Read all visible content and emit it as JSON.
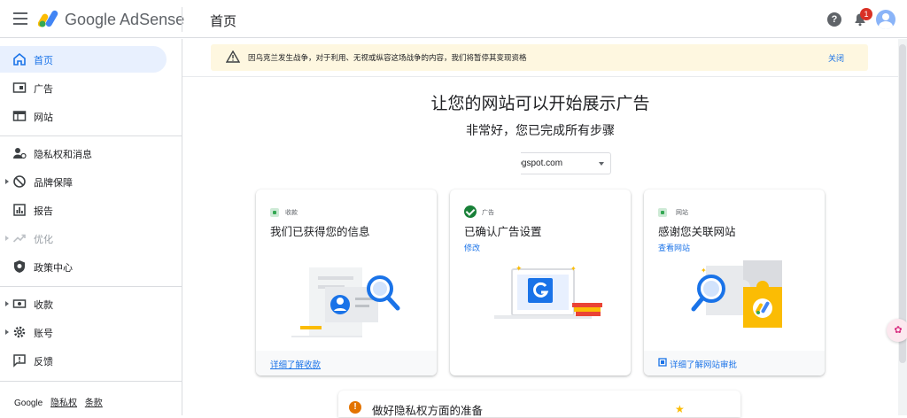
{
  "header": {
    "app_name": "Google AdSense",
    "page_title": "首页",
    "help_glyph": "?",
    "notification_count": "1"
  },
  "sidebar": {
    "items": [
      {
        "label": "首页",
        "icon": "home-icon",
        "active": true
      },
      {
        "label": "广告",
        "icon": "ads-icon"
      },
      {
        "label": "网站",
        "icon": "sites-icon"
      },
      {
        "label": "隐私权和消息",
        "icon": "privacy-messaging-icon"
      },
      {
        "label": "品牌保障",
        "icon": "brand-safety-icon",
        "expandable": true
      },
      {
        "label": "报告",
        "icon": "reports-icon"
      },
      {
        "label": "优化",
        "icon": "optimization-icon",
        "expandable": true,
        "disabled": true
      },
      {
        "label": "政策中心",
        "icon": "policy-center-icon"
      },
      {
        "label": "收款",
        "icon": "payments-icon",
        "expandable": true
      },
      {
        "label": "账号",
        "icon": "account-gear-icon",
        "expandable": true
      },
      {
        "label": "反馈",
        "icon": "feedback-icon"
      }
    ],
    "footer": {
      "google": "Google",
      "privacy": "隐私权",
      "terms": "条款"
    }
  },
  "alert": {
    "text": "因乌克兰发生战争，对于利用、无视或纵容这场战争的内容，我们将暂停其变现资格",
    "close_label": "关闭"
  },
  "main": {
    "headline": "让您的网站可以开始展示广告",
    "subhead": "非常好，您已完成所有步骤",
    "site_select_value": "in.blogspot.com"
  },
  "cards": [
    {
      "category": "收款",
      "title": "我们已获得您的信息",
      "link": "",
      "footer_link": "详细了解收款"
    },
    {
      "category": "广告",
      "title": "已确认广告设置",
      "link": "修改",
      "footer_link": ""
    },
    {
      "category": "网站",
      "title": "感谢您关联网站",
      "link": "查看网站",
      "footer_link": "详细了解网站审批"
    }
  ],
  "privacy_card": {
    "title": "做好隐私权方面的准备",
    "icon_glyph": "!"
  },
  "colors": {
    "accent": "#1a73e8",
    "alert_bg": "#fef7e0",
    "active_bg": "#e8f0fe",
    "success": "#188038"
  }
}
